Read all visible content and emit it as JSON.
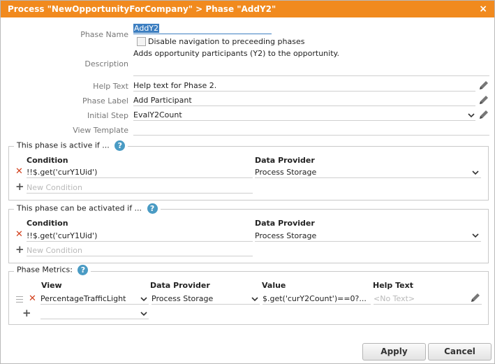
{
  "dialog": {
    "title": "Process \"NewOpportunityForCompany\" > Phase \"AddY2\"",
    "close_glyph": "×"
  },
  "form": {
    "phase_name_label": "Phase Name",
    "phase_name_value": "AddY2",
    "disable_nav_label": "Disable navigation to preceeding phases",
    "disable_nav_checked": false,
    "description_label": "Description",
    "description_value": "Adds opportunity participants (Y2) to the opportunity.",
    "help_text_label": "Help Text",
    "help_text_value": "Help text for Phase 2.",
    "phase_label_label": "Phase Label",
    "phase_label_value": "Add Participant",
    "initial_step_label": "Initial Step",
    "initial_step_value": "EvalY2Count",
    "view_template_label": "View Template",
    "view_template_value": ""
  },
  "active_group": {
    "title": "This phase is active if ...",
    "help_glyph": "?",
    "condition_header": "Condition",
    "provider_header": "Data Provider",
    "rows": [
      {
        "condition": "!!$.get('curY1Uid')",
        "provider": "Process Storage"
      }
    ],
    "new_condition_placeholder": "New Condition"
  },
  "activated_group": {
    "title": "This phase can be activated if ...",
    "help_glyph": "?",
    "condition_header": "Condition",
    "provider_header": "Data Provider",
    "rows": [
      {
        "condition": "!!$.get('curY1Uid')",
        "provider": "Process Storage"
      }
    ],
    "new_condition_placeholder": "New Condition"
  },
  "metrics_group": {
    "title": "Phase Metrics:",
    "help_glyph": "?",
    "headers": {
      "view": "View",
      "provider": "Data Provider",
      "value": "Value",
      "help_text": "Help Text"
    },
    "rows": [
      {
        "view": "PercentageTrafficLight",
        "provider": "Process Storage",
        "value": "$.get('curY2Count')==0?...",
        "help_text": "<No Text>"
      }
    ]
  },
  "buttons": {
    "apply": "Apply",
    "cancel": "Cancel"
  },
  "colors": {
    "accent": "#f18a1e",
    "delete": "#d2401c",
    "help": "#4a9bc4"
  }
}
